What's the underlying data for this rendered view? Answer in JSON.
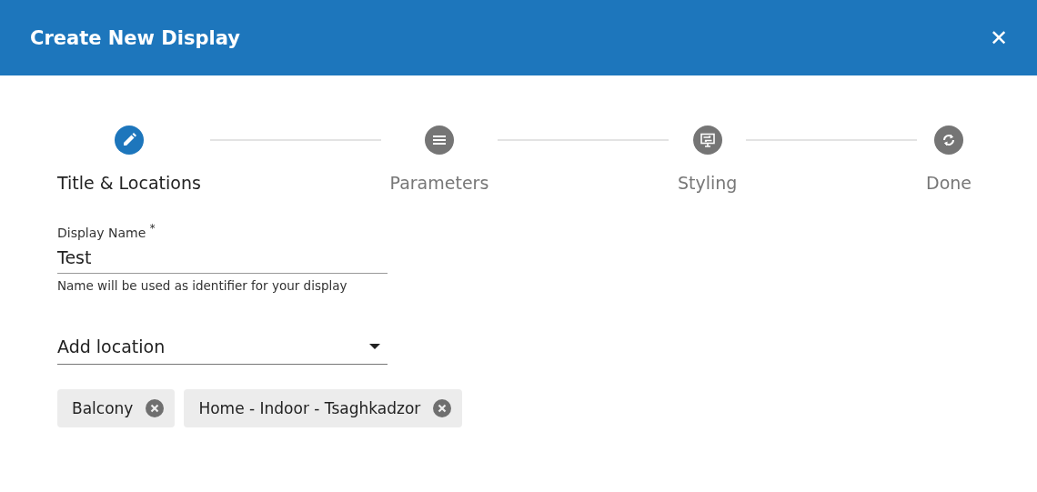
{
  "dialog": {
    "title": "Create New Display",
    "close": "✕"
  },
  "steps": [
    {
      "label": "Title & Locations",
      "kind": "pencil",
      "selected": true
    },
    {
      "label": "Parameters",
      "kind": "lines",
      "selected": false
    },
    {
      "label": "Styling",
      "kind": "monitor",
      "selected": false
    },
    {
      "label": "Done",
      "kind": "sync",
      "selected": false
    }
  ],
  "name_field": {
    "label": "Display Name $^{*}$",
    "value": "Test",
    "hint": "Name will be used as identifier for your display"
  },
  "location_select": {
    "placeholder": "Add location"
  },
  "chips": [
    {
      "label": "Balcony"
    },
    {
      "label": "Home - Indoor - Tsaghkadzor"
    }
  ]
}
